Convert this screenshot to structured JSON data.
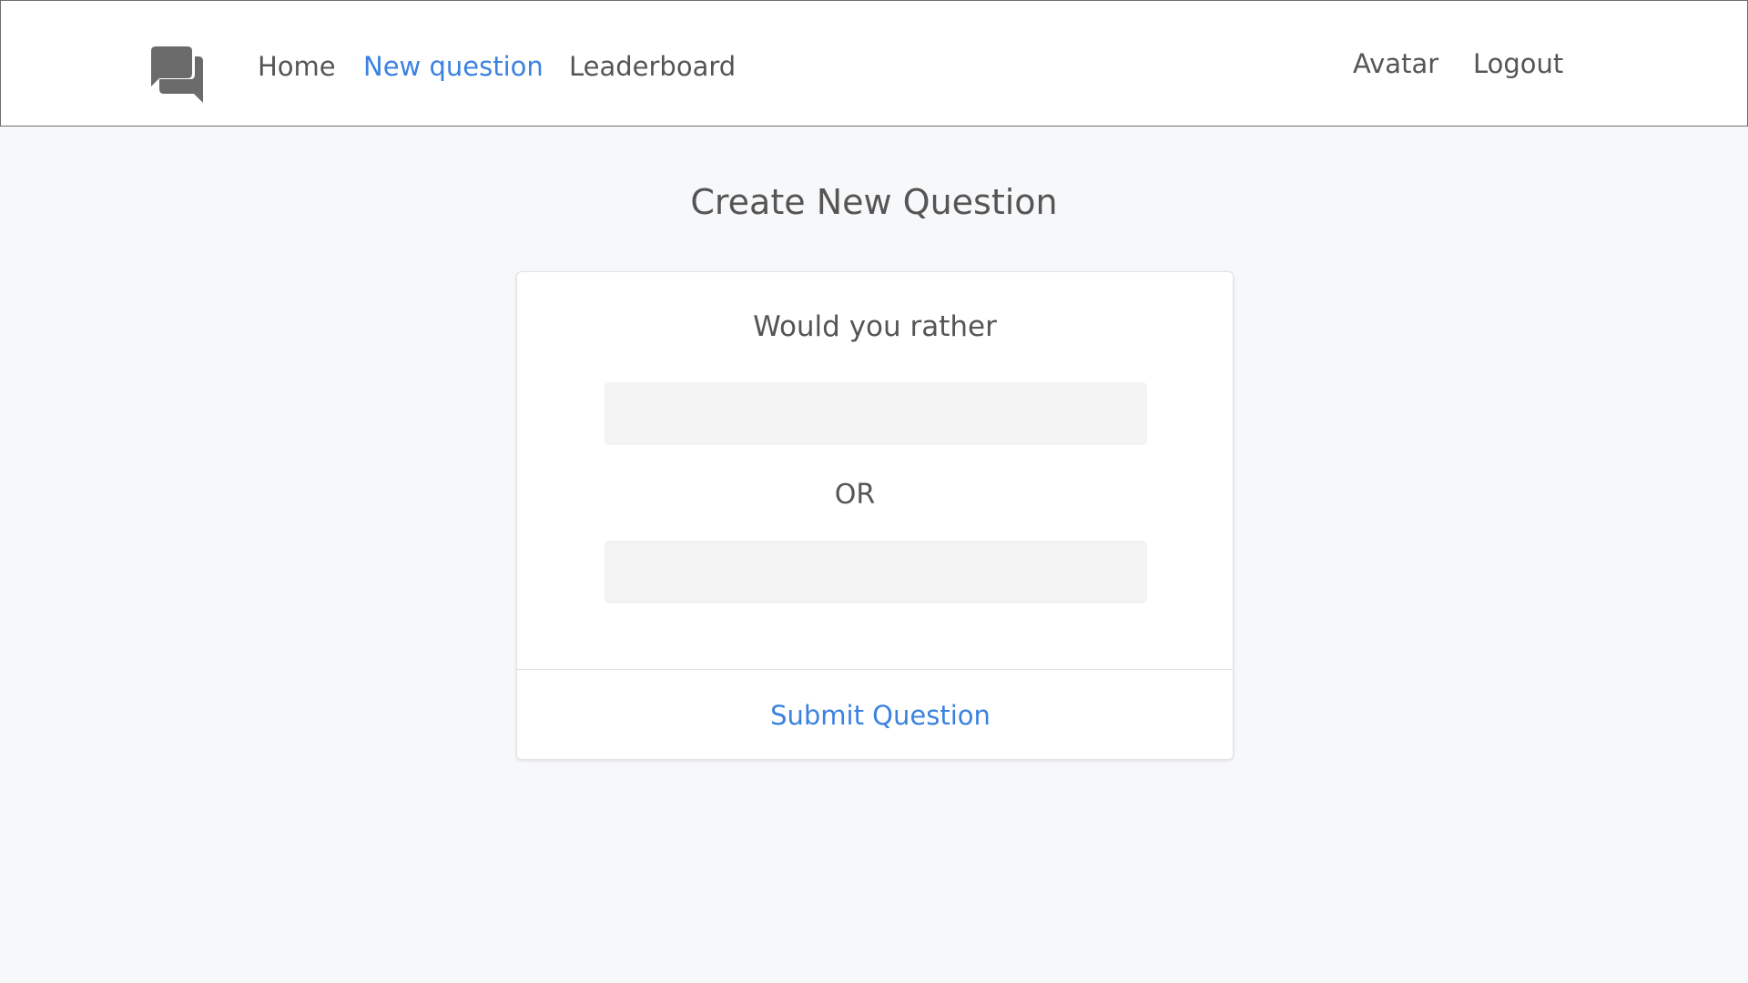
{
  "nav": {
    "logo_icon": "question-answer-icon",
    "home_label": "Home",
    "new_question_label": "New question",
    "leaderboard_label": "Leaderboard",
    "avatar_label": "Avatar",
    "logout_label": "Logout",
    "active_item": "New question"
  },
  "page": {
    "title": "Create New Question"
  },
  "form": {
    "heading": "Would you rather",
    "option_one_value": "",
    "option_one_placeholder": "",
    "separator": "OR",
    "option_two_value": "",
    "option_two_placeholder": "",
    "submit_label": "Submit Question"
  },
  "colors": {
    "accent": "#3b82e0",
    "text": "#555555",
    "background": "#f7f8fa",
    "input_background": "#f3f3f3"
  }
}
